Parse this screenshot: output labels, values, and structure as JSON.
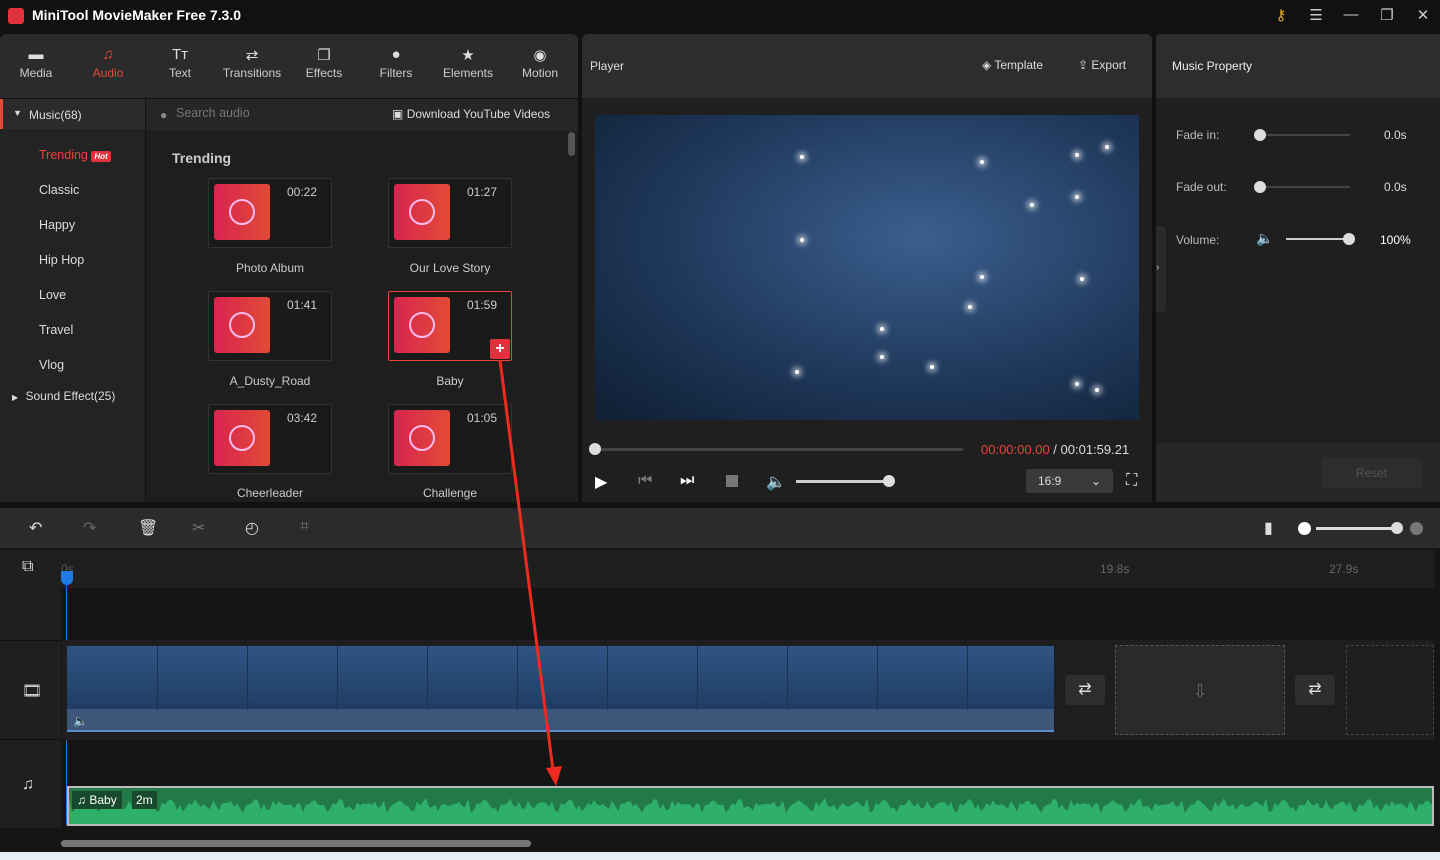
{
  "app": {
    "title": "MiniTool MovieMaker Free 7.3.0",
    "icons": [
      "key-icon",
      "menu-icon",
      "minimize-icon",
      "maximize-icon",
      "close-icon"
    ]
  },
  "tabs": [
    {
      "label": "Media",
      "icon": "▬"
    },
    {
      "label": "Audio",
      "icon": "♫"
    },
    {
      "label": "Text",
      "icon": "Tт"
    },
    {
      "label": "Transitions",
      "icon": "⇄"
    },
    {
      "label": "Effects",
      "icon": "❐"
    },
    {
      "label": "Filters",
      "icon": "●"
    },
    {
      "label": "Elements",
      "icon": "★"
    },
    {
      "label": "Motion",
      "icon": "◉"
    }
  ],
  "library": {
    "music_group": "Music(68)",
    "categories": [
      "Trending",
      "Classic",
      "Happy",
      "Hip Hop",
      "Love",
      "Travel",
      "Vlog"
    ],
    "hot_badge": "Hot",
    "sound_group": "Sound Effect(25)",
    "search_placeholder": "Search audio",
    "download_label": "Download YouTube Videos",
    "section_title": "Trending",
    "items": [
      {
        "name": "Photo Album",
        "duration": "00:22"
      },
      {
        "name": "Our Love Story",
        "duration": "01:27"
      },
      {
        "name": "A_Dusty_Road",
        "duration": "01:41"
      },
      {
        "name": "Baby",
        "duration": "01:59",
        "selected": true
      },
      {
        "name": "Cheerleader",
        "duration": "03:42"
      },
      {
        "name": "Challenge",
        "duration": "01:05"
      }
    ]
  },
  "player": {
    "title": "Player",
    "template_label": "Template",
    "export_label": "Export",
    "current_time": "00:00:00.00",
    "separator": " / ",
    "total_time": "00:01:59.21",
    "progress": 0,
    "volume": 100,
    "aspect_ratio": "16:9"
  },
  "property": {
    "title": "Music Property",
    "fade_in_label": "Fade in:",
    "fade_in_value": "0.0s",
    "fade_out_label": "Fade out:",
    "fade_out_value": "0.0s",
    "volume_label": "Volume:",
    "volume_value": "100%",
    "reset_label": "Reset"
  },
  "timeline": {
    "ruler": [
      "0s",
      "19.8s",
      "27.9s"
    ],
    "audio_clip": {
      "name": "Baby",
      "length": "2m"
    },
    "zoom_level": 100
  },
  "colors": {
    "accent": "#e8453c",
    "playhead": "#1e7be6",
    "audio": "#2a9a5a"
  }
}
